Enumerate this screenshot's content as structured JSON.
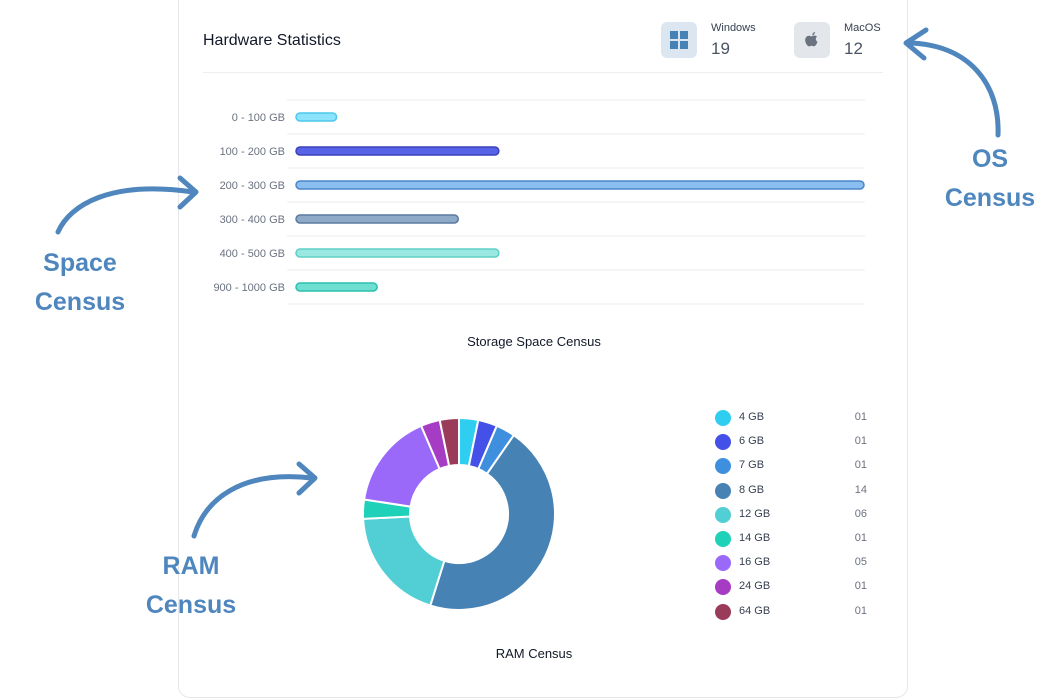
{
  "card": {
    "title": "Hardware Statistics",
    "os_stats": [
      {
        "label": "Windows",
        "value": "19",
        "icon": "windows-icon"
      },
      {
        "label": "MacOS",
        "value": "12",
        "icon": "apple-icon"
      }
    ]
  },
  "chart_data": [
    {
      "type": "bar",
      "orientation": "horizontal",
      "title": "Storage Space Census",
      "categories": [
        "0 - 100 GB",
        "100 - 200 GB",
        "200 - 300 GB",
        "300 - 400 GB",
        "400 - 500 GB",
        "900 - 1000 GB"
      ],
      "values": [
        1,
        5,
        14,
        4,
        5,
        2
      ],
      "colors": [
        "#8be4fb",
        "#5762e6",
        "#8bbef0",
        "#8fa9c9",
        "#9be8e2",
        "#6fdfd1"
      ],
      "borders": [
        "#4fc8ec",
        "#3a41b8",
        "#4a85c8",
        "#5c7aa0",
        "#5fcfc6",
        "#2cbfae"
      ],
      "xlim": [
        0,
        14
      ],
      "grid": true,
      "legend": "none"
    },
    {
      "type": "pie",
      "style": "donut",
      "title": "RAM Census",
      "categories": [
        "4 GB",
        "6 GB",
        "7 GB",
        "8 GB",
        "12 GB",
        "14 GB",
        "16 GB",
        "24 GB",
        "64 GB"
      ],
      "values": [
        1,
        1,
        1,
        14,
        6,
        1,
        5,
        1,
        1
      ],
      "value_labels": [
        "01",
        "01",
        "01",
        "14",
        "06",
        "01",
        "05",
        "01",
        "01"
      ],
      "colors": [
        "#2fcdf0",
        "#4451e8",
        "#3f8fdf",
        "#4682b4",
        "#52cfd4",
        "#1fd1b8",
        "#9b69fa",
        "#a63bc4",
        "#9a3b59"
      ],
      "legend": "right"
    }
  ],
  "callouts": [
    {
      "name": "os-census-callout",
      "text": "OS\nCensus"
    },
    {
      "name": "space-census-callout",
      "text": "Space\nCensus"
    },
    {
      "name": "ram-census-callout",
      "text": "RAM\nCensus"
    }
  ]
}
